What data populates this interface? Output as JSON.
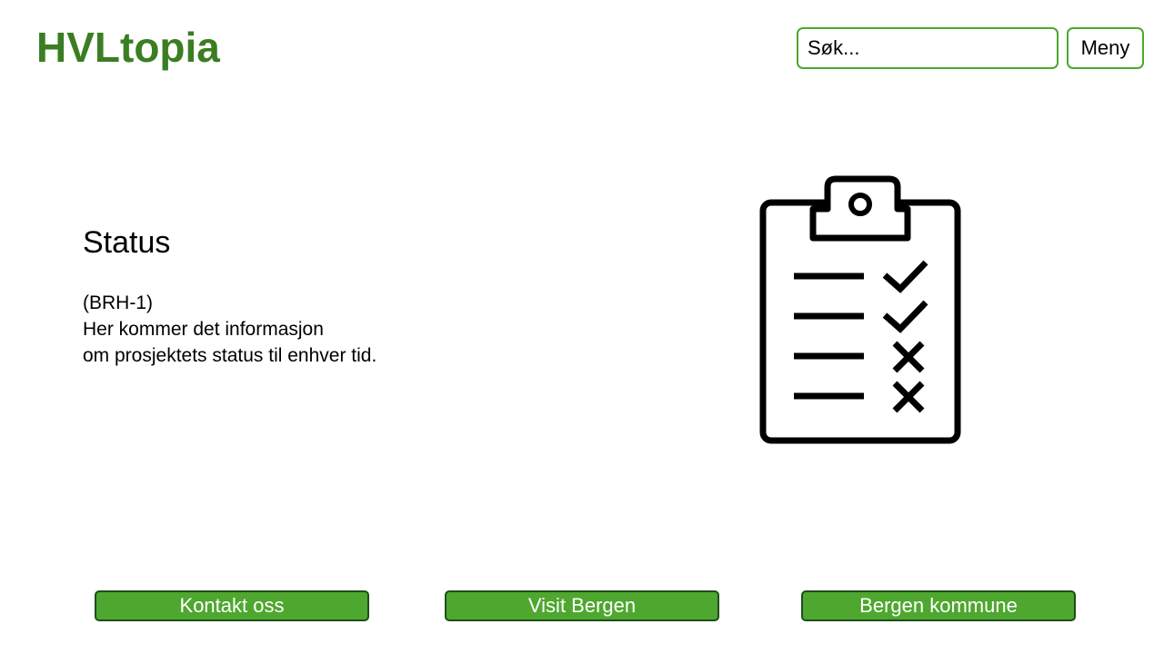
{
  "header": {
    "logo_text": "HVLtopia",
    "search_placeholder": "Søk...",
    "menu_label": "Meny"
  },
  "main": {
    "title": "Status",
    "description_lines": [
      "(BRH-1)",
      "Her kommer det informasjon",
      "om prosjektets status til enhver tid."
    ],
    "illustration_icon": "clipboard-checklist-icon"
  },
  "footer": {
    "buttons": [
      {
        "label": "Kontakt oss"
      },
      {
        "label": "Visit Bergen"
      },
      {
        "label": "Bergen kommune"
      }
    ]
  },
  "colors": {
    "brand_green": "#3b7d23",
    "button_green": "#4ea72e",
    "button_border": "#1f4e1b"
  }
}
